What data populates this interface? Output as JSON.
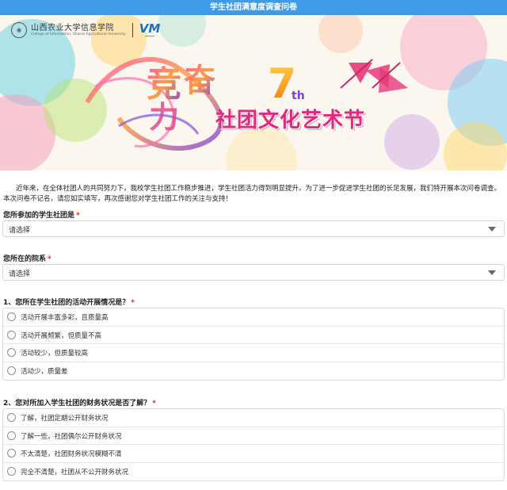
{
  "header": {
    "title": "学生社团满意度调查问卷"
  },
  "banner": {
    "university_cn": "山西农业大学信息学院",
    "university_en": "College of Information, Shanxi Agricultural University",
    "partner_logo": "VM",
    "partner_sub": "vm-logo-subtitle",
    "festival_number": "7",
    "festival_suffix": "th",
    "festival_title": "社团文化艺术节",
    "banner_art_text": "竞奋"
  },
  "intro": "近年来，在全体社团人的共同努力下，我校学生社团工作稳步推进，学生社团活力得到明显提升。为了进一步促进学生社团的长足发展，我们特开展本次问卷调查。本次问卷不记名，请您如实填写，再次感谢您对学生社团工作的关注与支持！",
  "questions": {
    "club": {
      "label": "您所参加的学生社团是",
      "required": "*",
      "value": "请选择"
    },
    "department": {
      "label": "您所在的院系",
      "required": "*",
      "value": "请选择"
    },
    "q1": {
      "label": "1、您所在学生社团的活动开展情况是？",
      "required": "*",
      "options": [
        "活动开展丰富多彩，且质量高",
        "活动开展频繁，但质量不高",
        "活动较少，但质量较高",
        "活动少，质量差"
      ]
    },
    "q2": {
      "label": "2、您对所加入学生社团的财务状况是否了解？",
      "required": "*",
      "options": [
        "了解，社团定期公开财务状况",
        "了解一些，社团偶尔公开财务状况",
        "不太清楚，社团财务状况模糊不清",
        "完全不清楚，社团从不公开财务状况"
      ]
    }
  },
  "colors": {
    "header_bg": "#3f9be8",
    "required": "#e02020",
    "festival_title": "#e0287e"
  },
  "icons": {
    "dropdown": "chevron-down-icon",
    "radio": "radio-icon"
  }
}
